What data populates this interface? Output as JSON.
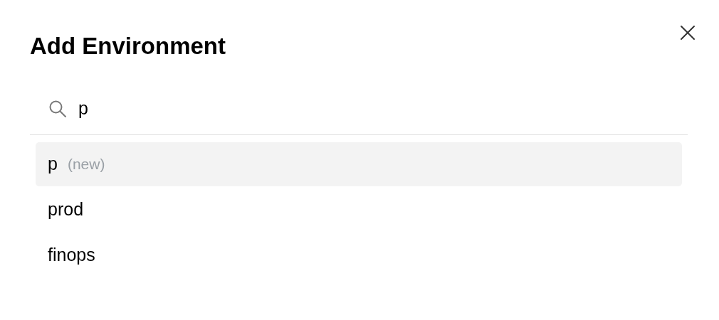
{
  "dialog": {
    "title": "Add Environment"
  },
  "search": {
    "value": "p"
  },
  "options": [
    {
      "label": "p",
      "note": "(new)",
      "selected": true
    },
    {
      "label": "prod",
      "selected": false
    },
    {
      "label": "finops",
      "selected": false
    }
  ]
}
